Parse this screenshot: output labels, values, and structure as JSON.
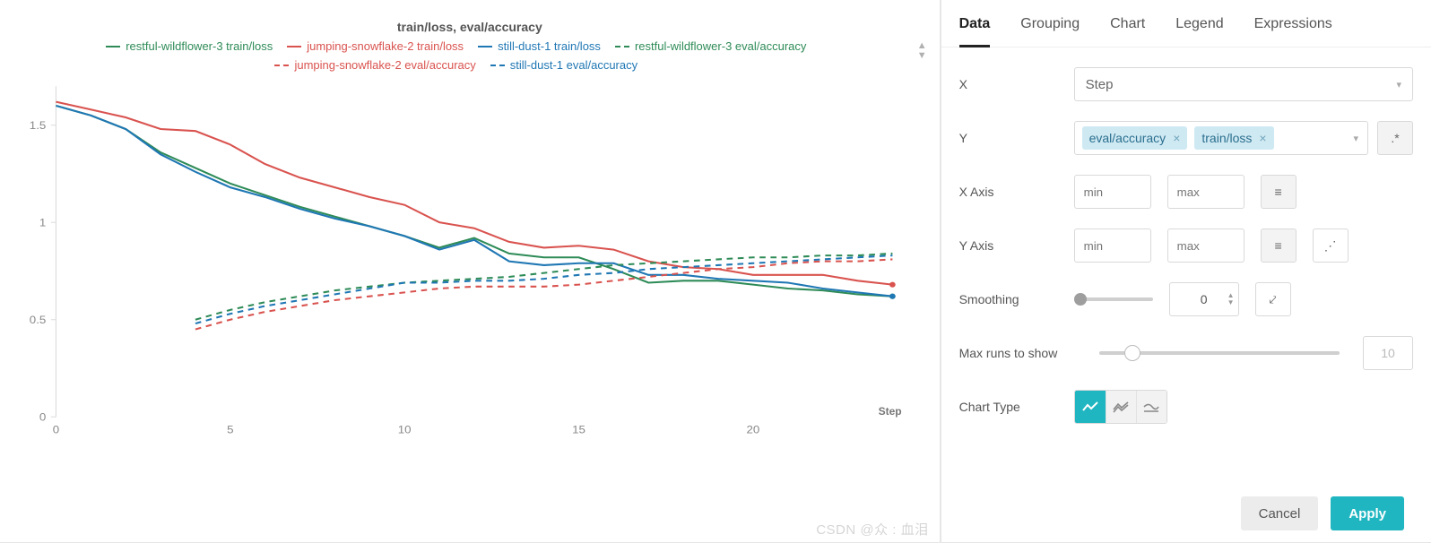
{
  "chart_title": "train/loss, eval/accuracy",
  "legend": [
    {
      "label": "restful-wildflower-3 train/loss",
      "cls": "g",
      "dash": false
    },
    {
      "label": "jumping-snowflake-2 train/loss",
      "cls": "r",
      "dash": false
    },
    {
      "label": "still-dust-1 train/loss",
      "cls": "b",
      "dash": false
    },
    {
      "label": "restful-wildflower-3 eval/accuracy",
      "cls": "g",
      "dash": true
    },
    {
      "label": "jumping-snowflake-2 eval/accuracy",
      "cls": "r",
      "dash": true
    },
    {
      "label": "still-dust-1 eval/accuracy",
      "cls": "b",
      "dash": true
    }
  ],
  "xaxis_label": "Step",
  "tabs": [
    "Data",
    "Grouping",
    "Chart",
    "Legend",
    "Expressions"
  ],
  "active_tab": "Data",
  "controls": {
    "x_label": "X",
    "x_value": "Step",
    "y_label": "Y",
    "y_chips": [
      "train/loss",
      "eval/accuracy"
    ],
    "regex_btn": ".*",
    "x_axis_label": "X Axis",
    "y_axis_label": "Y Axis",
    "min_ph": "min",
    "max_ph": "max",
    "smoothing_label": "Smoothing",
    "smoothing_value": "0",
    "maxruns_label": "Max runs to show",
    "maxruns_value": "10",
    "chart_type_label": "Chart Type"
  },
  "buttons": {
    "cancel": "Cancel",
    "apply": "Apply"
  },
  "watermark": "CSDN @众 : 血泪",
  "chart_data": {
    "type": "line",
    "xlabel": "Step",
    "ylabel": "",
    "xlim": [
      0,
      24
    ],
    "ylim": [
      0,
      1.7
    ],
    "y_ticks": [
      0,
      0.5,
      1,
      1.5
    ],
    "x_ticks": [
      0,
      5,
      10,
      15,
      20
    ],
    "series": [
      {
        "name": "restful-wildflower-3 train/loss",
        "color": "#2e8b57",
        "dash": false,
        "x": [
          0,
          1,
          2,
          3,
          4,
          5,
          6,
          7,
          8,
          9,
          10,
          11,
          12,
          13,
          14,
          15,
          16,
          17,
          18,
          19,
          20,
          21,
          22,
          23,
          24
        ],
        "y": [
          1.6,
          1.55,
          1.48,
          1.36,
          1.28,
          1.2,
          1.14,
          1.08,
          1.03,
          0.98,
          0.93,
          0.87,
          0.92,
          0.84,
          0.82,
          0.82,
          0.76,
          0.69,
          0.7,
          0.7,
          0.68,
          0.66,
          0.65,
          0.63,
          0.62
        ]
      },
      {
        "name": "jumping-snowflake-2 train/loss",
        "color": "#d9534f",
        "dash": false,
        "x": [
          0,
          1,
          2,
          3,
          4,
          5,
          6,
          7,
          8,
          9,
          10,
          11,
          12,
          13,
          14,
          15,
          16,
          17,
          18,
          19,
          20,
          21,
          22,
          23,
          24
        ],
        "y": [
          1.62,
          1.58,
          1.54,
          1.48,
          1.47,
          1.4,
          1.3,
          1.23,
          1.18,
          1.13,
          1.09,
          1.0,
          0.97,
          0.9,
          0.87,
          0.88,
          0.86,
          0.8,
          0.77,
          0.76,
          0.73,
          0.73,
          0.73,
          0.7,
          0.68
        ]
      },
      {
        "name": "still-dust-1 train/loss",
        "color": "#1f77b4",
        "dash": false,
        "x": [
          0,
          1,
          2,
          3,
          4,
          5,
          6,
          7,
          8,
          9,
          10,
          11,
          12,
          13,
          14,
          15,
          16,
          17,
          18,
          19,
          20,
          21,
          22,
          23,
          24
        ],
        "y": [
          1.6,
          1.55,
          1.48,
          1.35,
          1.26,
          1.18,
          1.13,
          1.07,
          1.02,
          0.98,
          0.93,
          0.86,
          0.91,
          0.8,
          0.78,
          0.79,
          0.79,
          0.73,
          0.73,
          0.71,
          0.7,
          0.69,
          0.66,
          0.64,
          0.62
        ]
      },
      {
        "name": "restful-wildflower-3 eval/accuracy",
        "color": "#2e8b57",
        "dash": true,
        "x": [
          4,
          5,
          6,
          7,
          8,
          9,
          10,
          11,
          12,
          13,
          14,
          15,
          16,
          17,
          18,
          19,
          20,
          21,
          22,
          23,
          24
        ],
        "y": [
          0.5,
          0.55,
          0.59,
          0.62,
          0.65,
          0.67,
          0.69,
          0.7,
          0.71,
          0.72,
          0.74,
          0.76,
          0.78,
          0.79,
          0.8,
          0.81,
          0.82,
          0.82,
          0.83,
          0.83,
          0.84
        ]
      },
      {
        "name": "jumping-snowflake-2 eval/accuracy",
        "color": "#d9534f",
        "dash": true,
        "x": [
          4,
          5,
          6,
          7,
          8,
          9,
          10,
          11,
          12,
          13,
          14,
          15,
          16,
          17,
          18,
          19,
          20,
          21,
          22,
          23,
          24
        ],
        "y": [
          0.45,
          0.5,
          0.54,
          0.57,
          0.6,
          0.62,
          0.64,
          0.66,
          0.67,
          0.67,
          0.67,
          0.68,
          0.7,
          0.72,
          0.74,
          0.76,
          0.77,
          0.79,
          0.8,
          0.8,
          0.81
        ]
      },
      {
        "name": "still-dust-1 eval/accuracy",
        "color": "#1f77b4",
        "dash": true,
        "x": [
          4,
          5,
          6,
          7,
          8,
          9,
          10,
          11,
          12,
          13,
          14,
          15,
          16,
          17,
          18,
          19,
          20,
          21,
          22,
          23,
          24
        ],
        "y": [
          0.48,
          0.53,
          0.57,
          0.6,
          0.63,
          0.66,
          0.69,
          0.69,
          0.7,
          0.7,
          0.71,
          0.73,
          0.74,
          0.76,
          0.77,
          0.78,
          0.79,
          0.8,
          0.81,
          0.82,
          0.83
        ]
      }
    ]
  }
}
